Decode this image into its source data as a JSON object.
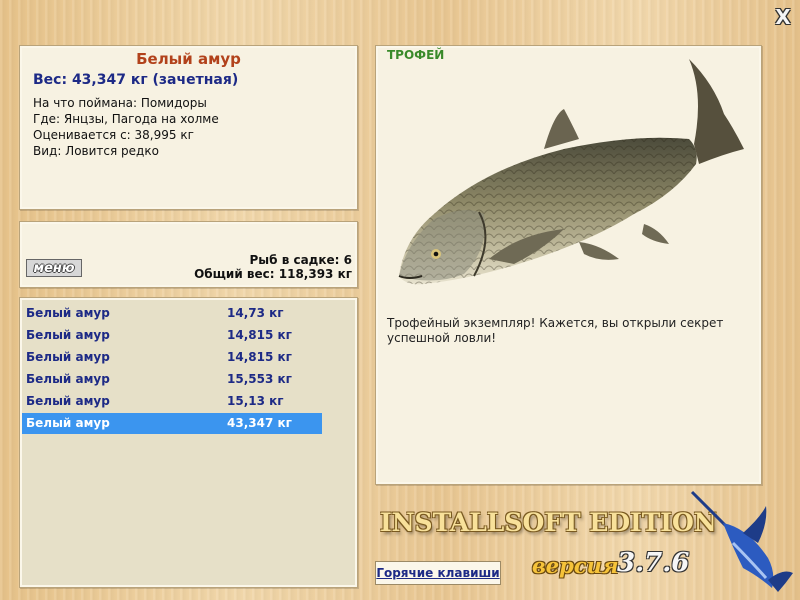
{
  "close_label": "X",
  "fish_info": {
    "name": "Белый амур",
    "weight_line": "Вес: 43,347 кг (зачетная)",
    "bait": "На что поймана: Помидоры",
    "location": "Где: Янцзы, Пагода на холме",
    "valued_from": "Оценивается с: 38,995 кг",
    "species_note": "Вид: Ловится редко"
  },
  "keepnet": {
    "menu_label": "меню",
    "fish_count": "Рыб в садке: 6",
    "total_weight": "Общий вес: 118,393 кг"
  },
  "catch_list": [
    {
      "name": "Белый амур",
      "weight": "14,73 кг"
    },
    {
      "name": "Белый амур",
      "weight": "14,815 кг"
    },
    {
      "name": "Белый амур",
      "weight": "14,815 кг"
    },
    {
      "name": "Белый амур",
      "weight": "15,553 кг"
    },
    {
      "name": "Белый амур",
      "weight": "15,13 кг"
    },
    {
      "name": "Белый амур",
      "weight": "43,347 кг"
    }
  ],
  "selected_row": 5,
  "trophy": {
    "label": "ТРОФЕЙ",
    "text": "Трофейный экземпляр! Кажется, вы открыли секрет успешной ловли!"
  },
  "hotkeys_label": "Горячие клавиши",
  "logo": {
    "edition": "INSTALLSOFT EDITION",
    "version_word": "версия",
    "version_number": "3.7.6"
  },
  "colors": {
    "accent_blue": "#1d2a86",
    "title_orange": "#b2421b",
    "selection": "#3b95ef",
    "trophy_green": "#3a8a2a"
  }
}
